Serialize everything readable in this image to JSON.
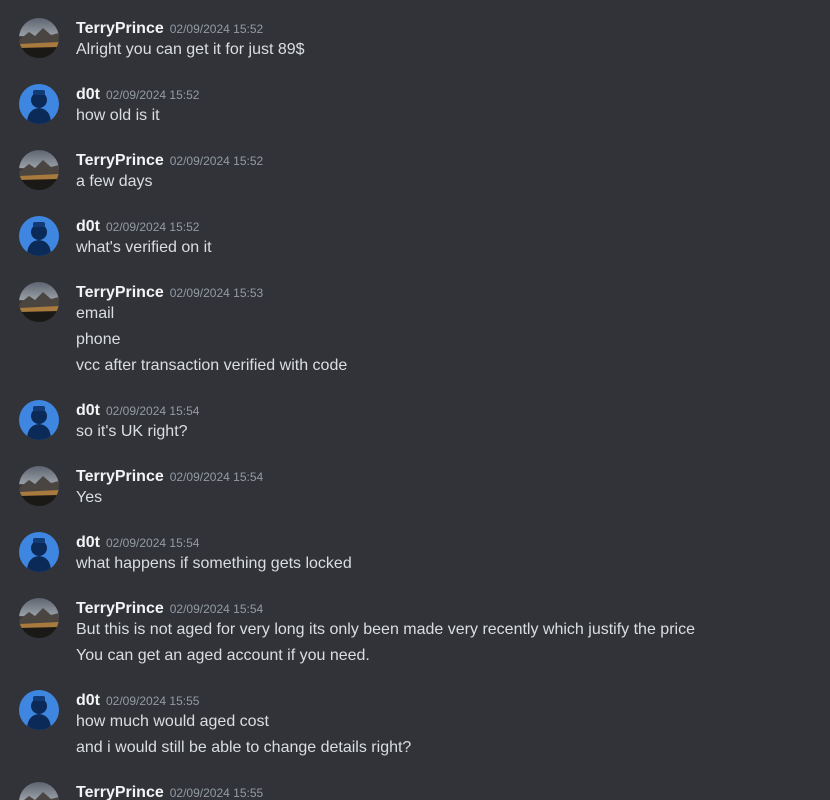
{
  "channel": {
    "messages": [
      {
        "author": "TerryPrince",
        "time": "02/09/2024 15:52",
        "lines": [
          "Alright you can get it for just 89$"
        ]
      },
      {
        "author": "d0t",
        "time": "02/09/2024 15:52",
        "lines": [
          "how old is it"
        ]
      },
      {
        "author": "TerryPrince",
        "time": "02/09/2024 15:52",
        "lines": [
          "a few days"
        ]
      },
      {
        "author": "d0t",
        "time": "02/09/2024 15:52",
        "lines": [
          "what's verified on it"
        ]
      },
      {
        "author": "TerryPrince",
        "time": "02/09/2024 15:53",
        "lines": [
          "email",
          "phone",
          "vcc after transaction verified with code"
        ]
      },
      {
        "author": "d0t",
        "time": "02/09/2024 15:54",
        "lines": [
          "so it's UK right?"
        ]
      },
      {
        "author": "TerryPrince",
        "time": "02/09/2024 15:54",
        "lines": [
          "Yes"
        ]
      },
      {
        "author": "d0t",
        "time": "02/09/2024 15:54",
        "lines": [
          "what happens if something gets locked"
        ]
      },
      {
        "author": "TerryPrince",
        "time": "02/09/2024 15:54",
        "lines": [
          "But this is not aged for very long its only been made very recently which justify the price",
          "You can get an aged account if you need."
        ]
      },
      {
        "author": "d0t",
        "time": "02/09/2024 15:55",
        "lines": [
          "how much would aged cost",
          "and i would still be able to change details right?"
        ]
      },
      {
        "author": "TerryPrince",
        "time": "02/09/2024 15:55",
        "lines": []
      }
    ]
  }
}
